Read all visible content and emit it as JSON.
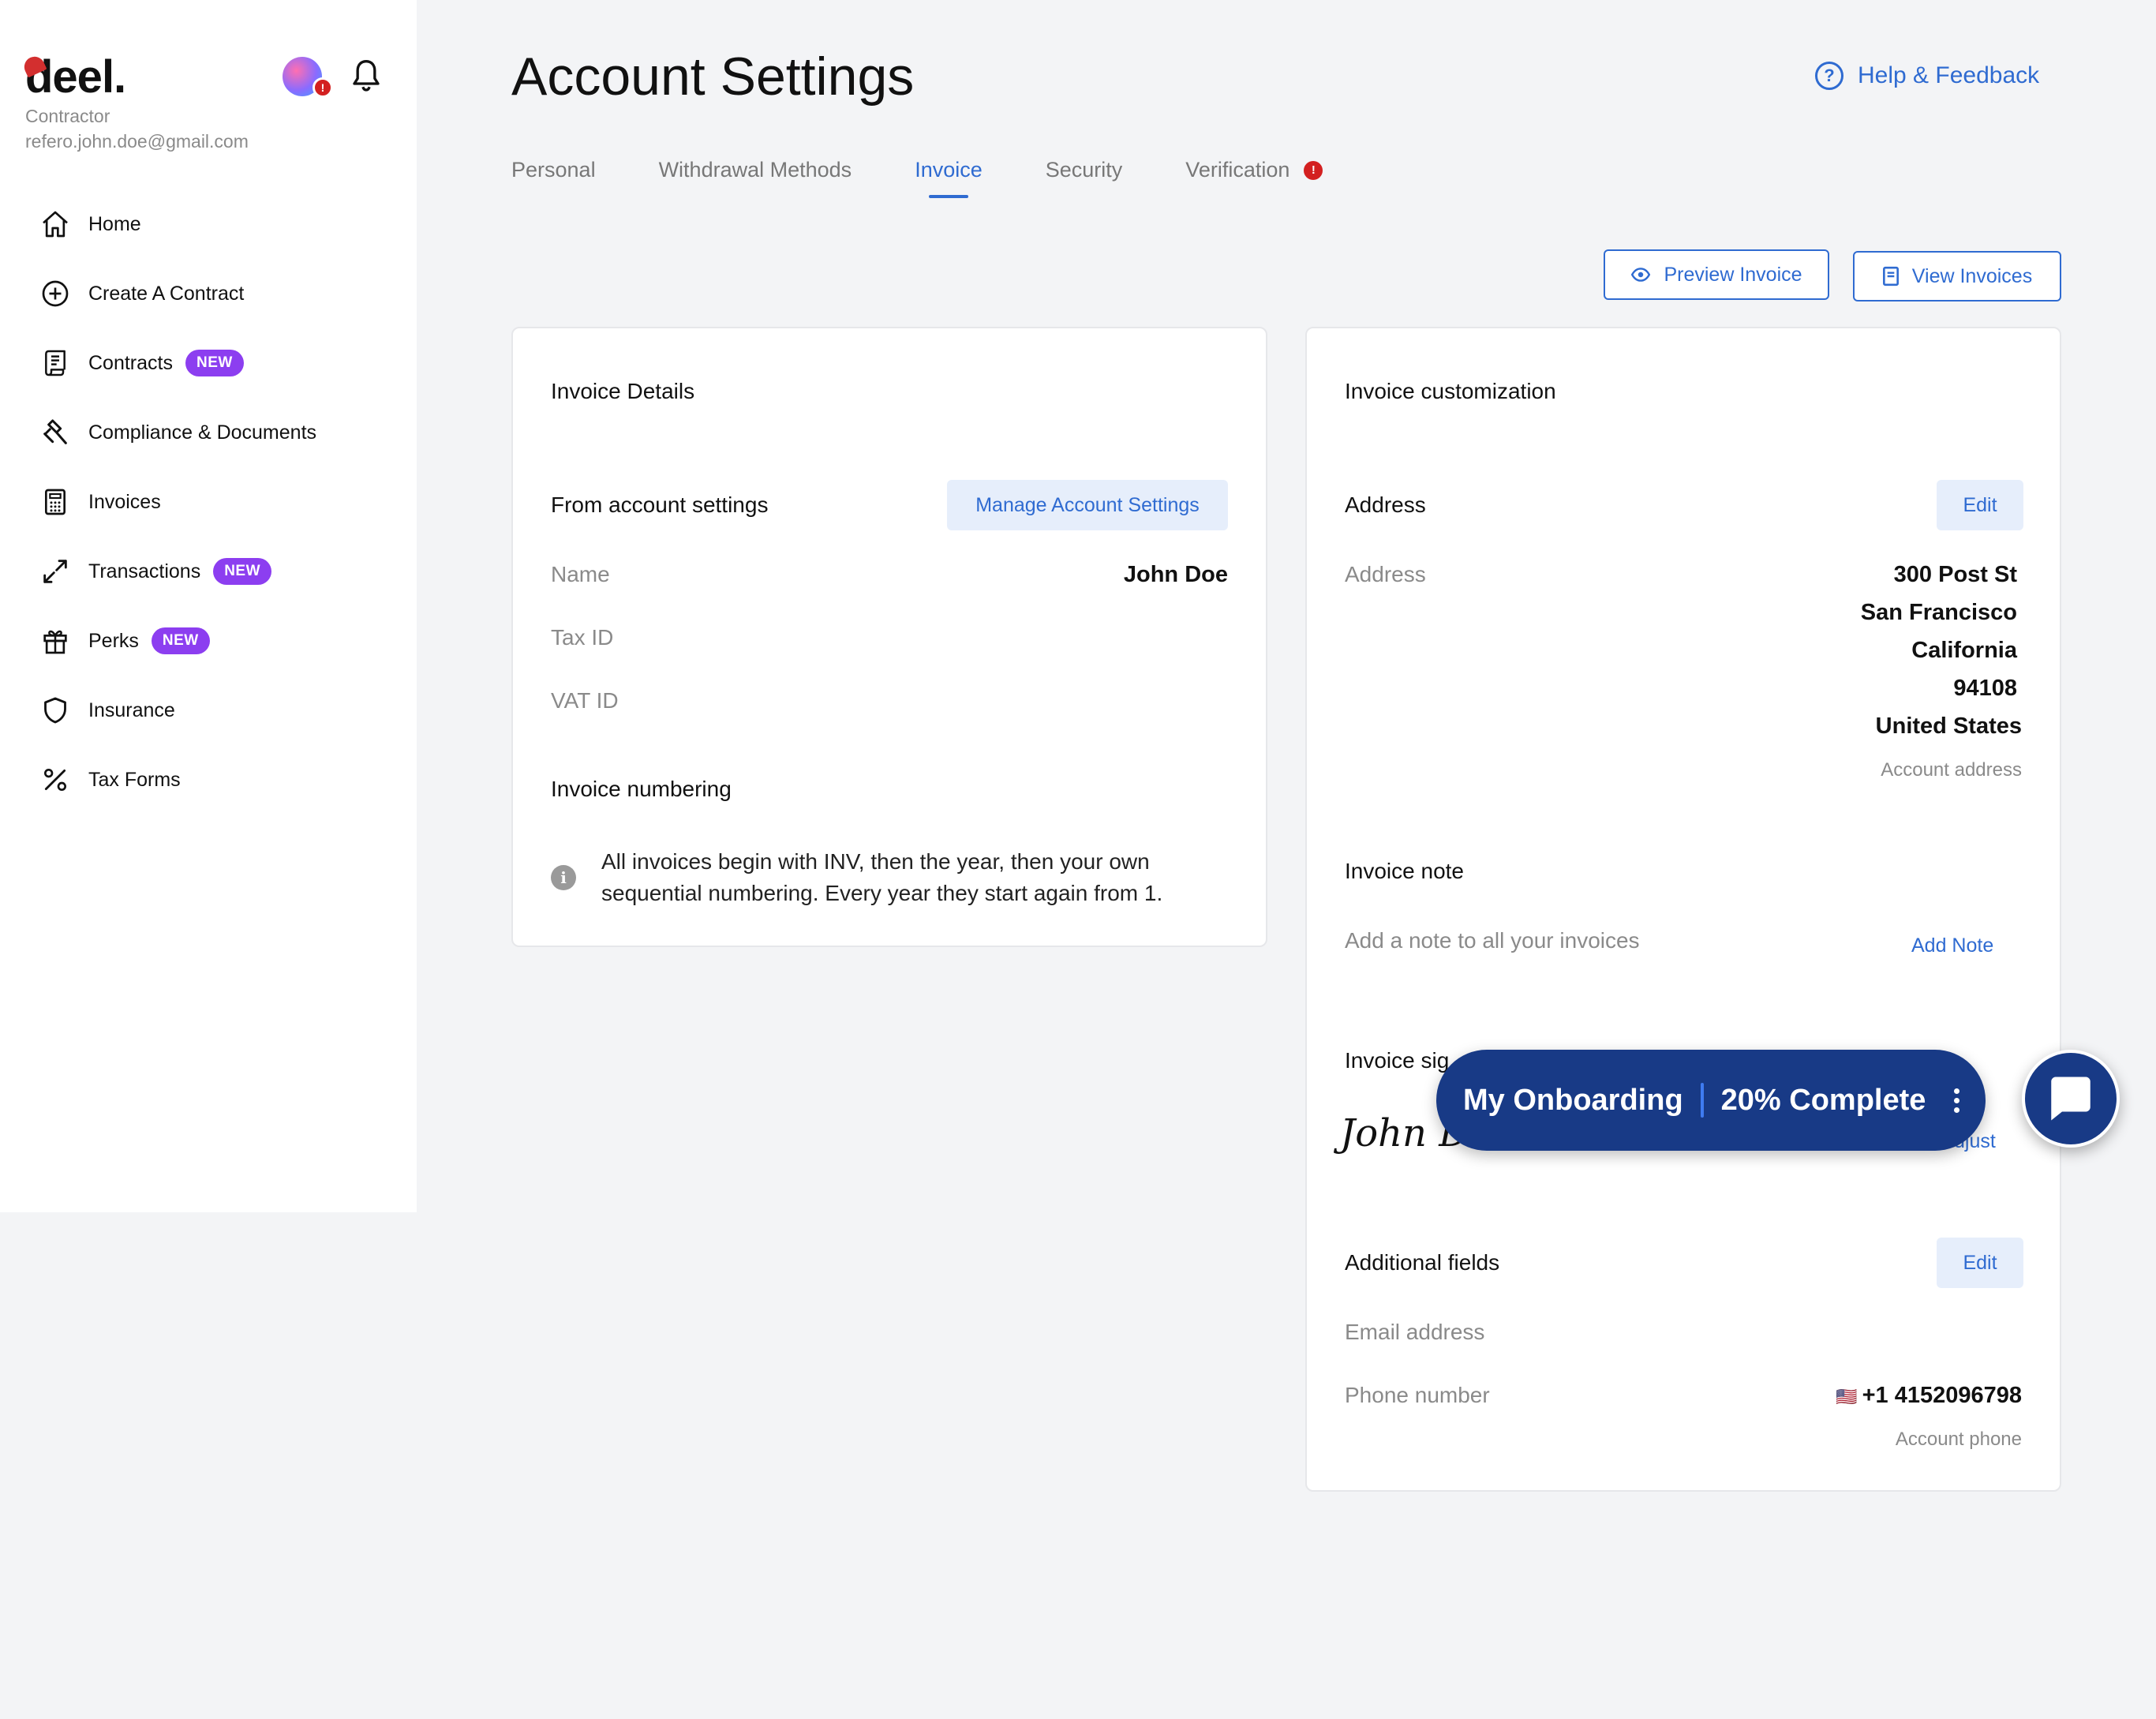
{
  "sidebar": {
    "logo": "deel.",
    "role": "Contractor",
    "email": "refero.john.doe@gmail.com",
    "avatar_badge": "!",
    "items": [
      {
        "label": "Home",
        "icon": "home-icon"
      },
      {
        "label": "Create A Contract",
        "icon": "plus-circle-icon"
      },
      {
        "label": "Contracts",
        "icon": "contract-icon",
        "badge": "NEW"
      },
      {
        "label": "Compliance & Documents",
        "icon": "gavel-icon"
      },
      {
        "label": "Invoices",
        "icon": "calculator-icon"
      },
      {
        "label": "Transactions",
        "icon": "arrows-icon",
        "badge": "NEW"
      },
      {
        "label": "Perks",
        "icon": "gift-icon",
        "badge": "NEW"
      },
      {
        "label": "Insurance",
        "icon": "shield-icon"
      },
      {
        "label": "Tax Forms",
        "icon": "percent-icon"
      }
    ]
  },
  "header": {
    "title": "Account Settings",
    "help": "Help & Feedback"
  },
  "tabs": [
    {
      "label": "Personal"
    },
    {
      "label": "Withdrawal Methods"
    },
    {
      "label": "Invoice",
      "active": true
    },
    {
      "label": "Security"
    },
    {
      "label": "Verification",
      "alert": "!"
    }
  ],
  "actions": {
    "preview": "Preview Invoice",
    "view": "View Invoices"
  },
  "invoice_details": {
    "title": "Invoice Details",
    "from_heading": "From account settings",
    "manage_button": "Manage Account Settings",
    "name_label": "Name",
    "name_value": "John Doe",
    "tax_label": "Tax ID",
    "vat_label": "VAT ID",
    "numbering_heading": "Invoice numbering",
    "numbering_line1": "All invoices begin with INV, then the year, then your own",
    "numbering_line2": "sequential numbering. Every year they start again from 1."
  },
  "customization": {
    "title": "Invoice customization",
    "address_heading": "Address",
    "edit_label": "Edit",
    "address_label": "Address",
    "address_lines": [
      "300 Post St",
      "San Francisco",
      "California",
      "94108",
      "United States"
    ],
    "address_note": "Account address",
    "note_heading": "Invoice note",
    "note_placeholder": "Add a note to all your invoices",
    "add_note": "Add Note",
    "signature_heading": "Invoice sig",
    "signature": "John Doe",
    "adjust": "djust",
    "additional_heading": "Additional fields",
    "additional_edit": "Edit",
    "email_label": "Email address",
    "phone_label": "Phone number",
    "phone_flag": "🇺🇸",
    "phone_value": "+1 4152096798",
    "phone_note": "Account phone"
  },
  "onboarding": {
    "label": "My Onboarding",
    "progress": "20% Complete",
    "progress_value": 0.2
  },
  "colors": {
    "accent": "#2f6bd1",
    "badge": "#8c3ef0",
    "onboarding_bg": "#183a86",
    "alert": "#d32020"
  }
}
